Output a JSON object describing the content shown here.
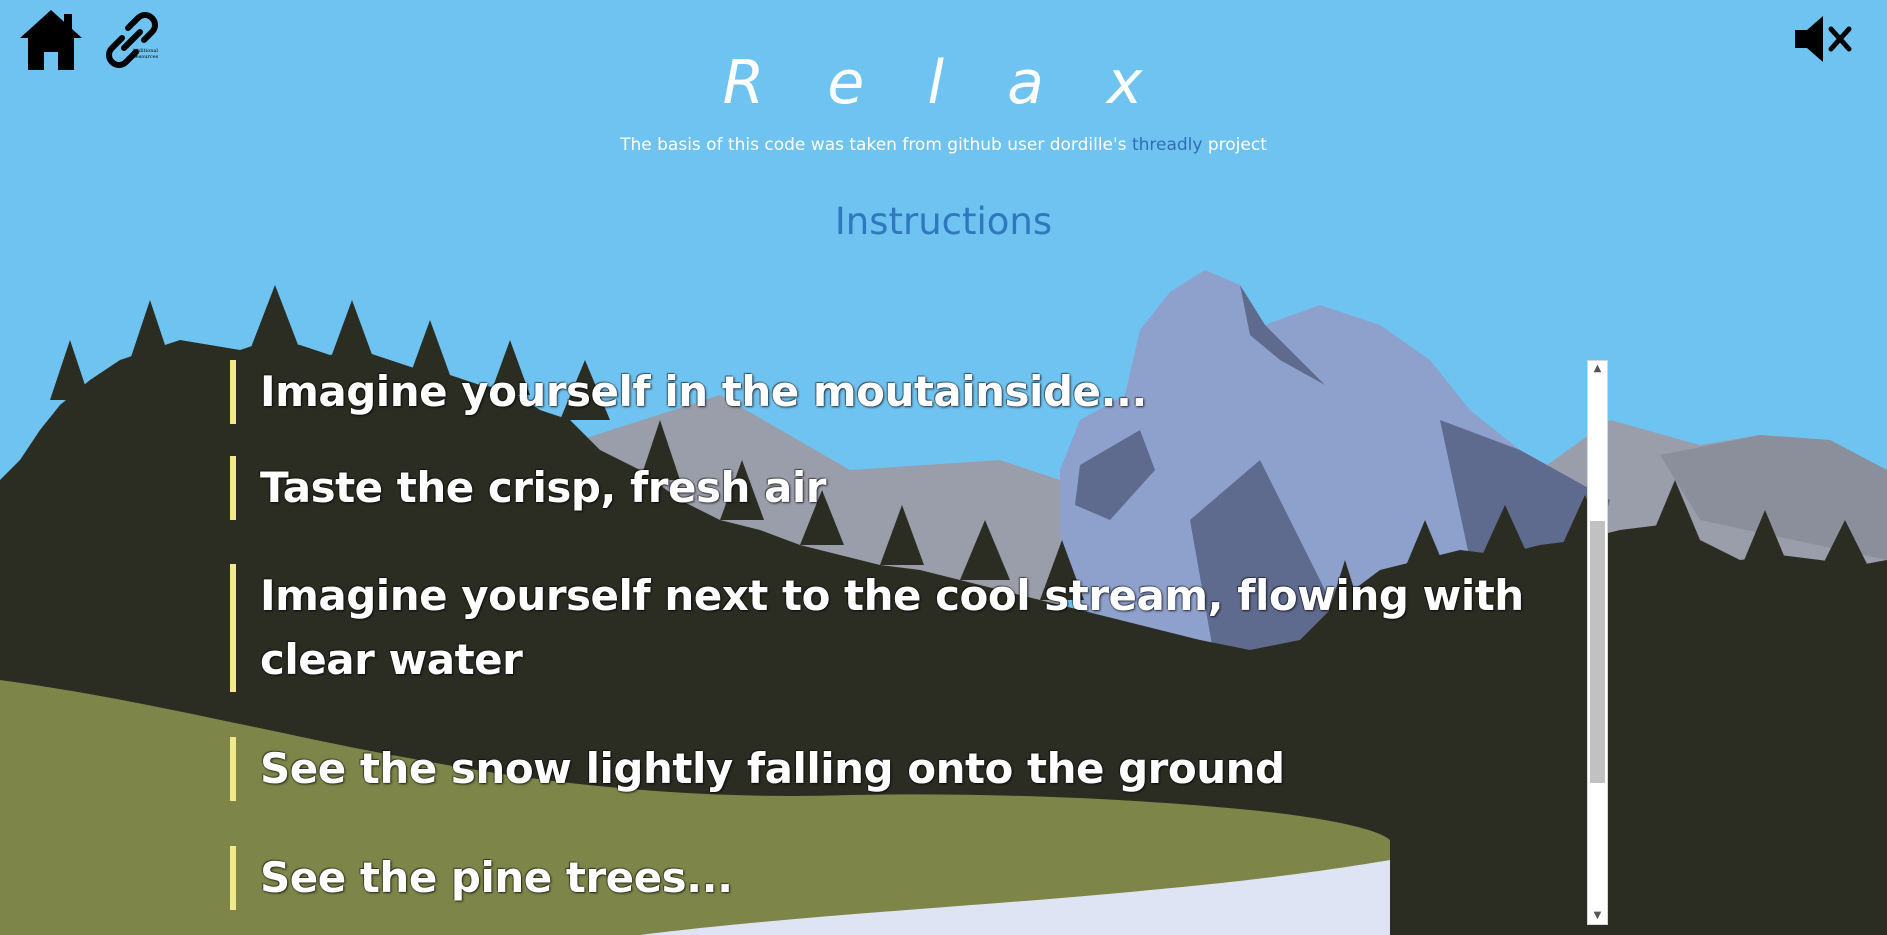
{
  "header": {
    "title": "R e l a x",
    "credit_prefix": "The basis of this code was taken from github user dordille's ",
    "credit_link": "threadly",
    "credit_suffix": " project",
    "links_icon_caption": "Additional Resources"
  },
  "icons": {
    "home": "home-icon",
    "links": "link-chain-icon",
    "mute": "speaker-muted-icon"
  },
  "instructions": {
    "heading": "Instructions",
    "items": [
      {
        "text": "Imagine yourself in the moutainside..."
      },
      {
        "text": "Taste the crisp, fresh air"
      },
      {
        "text": "Imagine yourself next to the cool stream, flowing with clear water"
      },
      {
        "text": "See the snow lightly falling onto the ground"
      },
      {
        "text": "See the pine trees..."
      }
    ]
  },
  "colors": {
    "sky": "#6fc3f1",
    "accent_bar": "#f4e98a",
    "heading": "#2f78bd",
    "link": "#2f6eb3",
    "grass": "#7d8549",
    "forest": "#2b2c22",
    "mountain": "#8aa0c8"
  }
}
